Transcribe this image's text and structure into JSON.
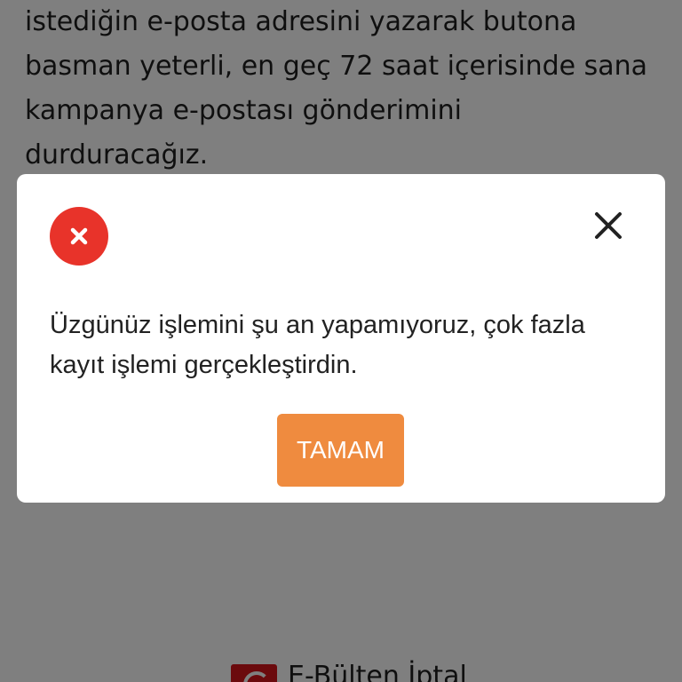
{
  "background": {
    "text_lines": [
      "istediğin e-posta adresini yazarak butona",
      "basman yeterli, en geç 72 saat içerisinde sana",
      "kampanya e-postası gönderimini",
      "durduracağız."
    ],
    "footer_label": "E-Bülten İptal"
  },
  "dialog": {
    "message_lines": [
      "Üzgünüz işlemini şu an yapamıyoruz, çok fazla",
      "kayıt işlemi gerçekleştirdin."
    ],
    "ok_label": "TAMAM",
    "icons": {
      "status": "error-icon",
      "close": "close-icon"
    }
  },
  "colors": {
    "error_red": "#e8332a",
    "button_orange": "#ef8b3f",
    "overlay": "#808080"
  }
}
